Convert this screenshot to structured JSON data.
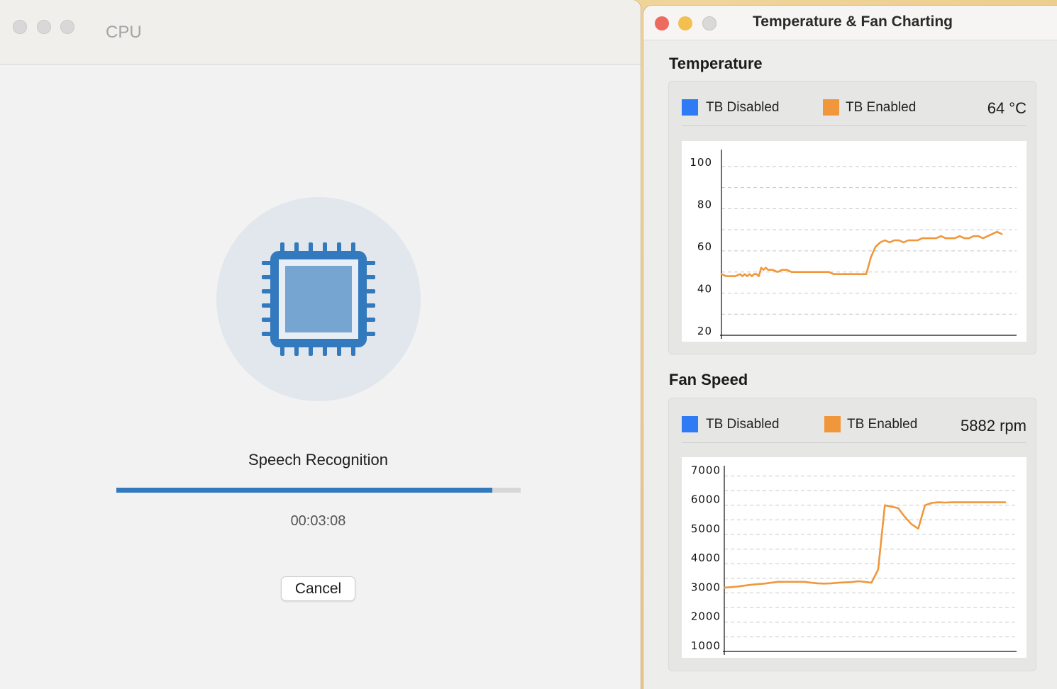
{
  "cpu_window": {
    "title": "CPU",
    "task_label": "Speech Recognition",
    "progress_fraction": 0.93,
    "elapsed": "00:03:08",
    "cancel_label": "Cancel",
    "icon": "cpu-chip-icon"
  },
  "chart_window": {
    "title": "Temperature & Fan Charting",
    "traffic_colors": {
      "close": "#ed6a5e",
      "minimize": "#f5bf4f",
      "zoom": "#d9d9d9"
    }
  },
  "temperature": {
    "heading": "Temperature",
    "legend": [
      {
        "label": "TB Disabled",
        "color": "#2f7bf6"
      },
      {
        "label": "TB Enabled",
        "color": "#f0973b"
      }
    ],
    "readout": "64 °C"
  },
  "fan_speed": {
    "heading": "Fan Speed",
    "legend": [
      {
        "label": "TB Disabled",
        "color": "#2f7bf6"
      },
      {
        "label": "TB Enabled",
        "color": "#f0973b"
      }
    ],
    "readout": "5882 rpm"
  },
  "chart_data": [
    {
      "type": "line",
      "ylim": [
        18,
        105
      ],
      "yticks": [
        100,
        80,
        60,
        40,
        20
      ],
      "grid": true,
      "series": [
        {
          "name": "TB Enabled",
          "color": "#f0973b",
          "x": [
            0,
            2,
            4,
            6,
            8,
            9,
            10,
            11,
            12,
            13,
            14,
            15,
            16,
            17,
            18,
            19,
            20,
            22,
            24,
            26,
            28,
            30,
            32,
            34,
            36,
            38,
            40,
            42,
            44,
            46,
            48,
            50,
            52,
            54,
            56,
            58,
            60,
            62,
            64,
            66,
            68,
            70,
            72,
            74,
            76,
            78,
            80,
            82,
            84,
            86,
            88,
            90,
            92,
            94,
            96,
            98,
            100,
            102,
            104,
            106,
            108,
            110,
            112,
            114,
            116,
            118,
            120
          ],
          "values": [
            47,
            46,
            46,
            46,
            47,
            46,
            47,
            46,
            47,
            46,
            47,
            47,
            46,
            50,
            49,
            50,
            49,
            49,
            48,
            49,
            49,
            48,
            48,
            48,
            48,
            48,
            48,
            48,
            48,
            48,
            47,
            47,
            47,
            47,
            47,
            47,
            47,
            47,
            55,
            60,
            62,
            63,
            62,
            63,
            63,
            62,
            63,
            63,
            63,
            64,
            64,
            64,
            64,
            65,
            64,
            64,
            64,
            65,
            64,
            64,
            65,
            65,
            64,
            65,
            66,
            67,
            66
          ]
        },
        {
          "name": "TB Disabled",
          "color": "#2f7bf6",
          "x": [],
          "values": []
        }
      ]
    },
    {
      "type": "line",
      "ylim": [
        800,
        7200
      ],
      "yticks": [
        7000,
        6000,
        5000,
        4000,
        3000,
        2000,
        1000
      ],
      "grid": true,
      "series": [
        {
          "name": "TB Enabled",
          "color": "#f0973b",
          "x": [
            0,
            3,
            6,
            9,
            12,
            15,
            18,
            21,
            24,
            27,
            30,
            33,
            36,
            39,
            42,
            45,
            48,
            51,
            54,
            57,
            60,
            63,
            66,
            69,
            72,
            75,
            78,
            81,
            84,
            87,
            90,
            93,
            96,
            99,
            102,
            105,
            108,
            111,
            114,
            117,
            120,
            123,
            126
          ],
          "values": [
            2980,
            3000,
            3020,
            3050,
            3080,
            3100,
            3120,
            3150,
            3180,
            3180,
            3180,
            3180,
            3180,
            3150,
            3130,
            3120,
            3130,
            3150,
            3160,
            3170,
            3200,
            3180,
            3150,
            3600,
            5800,
            5750,
            5700,
            5400,
            5150,
            5000,
            5800,
            5880,
            5900,
            5890,
            5900,
            5900,
            5900,
            5900,
            5900,
            5900,
            5900,
            5900,
            5900
          ]
        },
        {
          "name": "TB Disabled",
          "color": "#2f7bf6",
          "x": [],
          "values": []
        }
      ]
    }
  ]
}
